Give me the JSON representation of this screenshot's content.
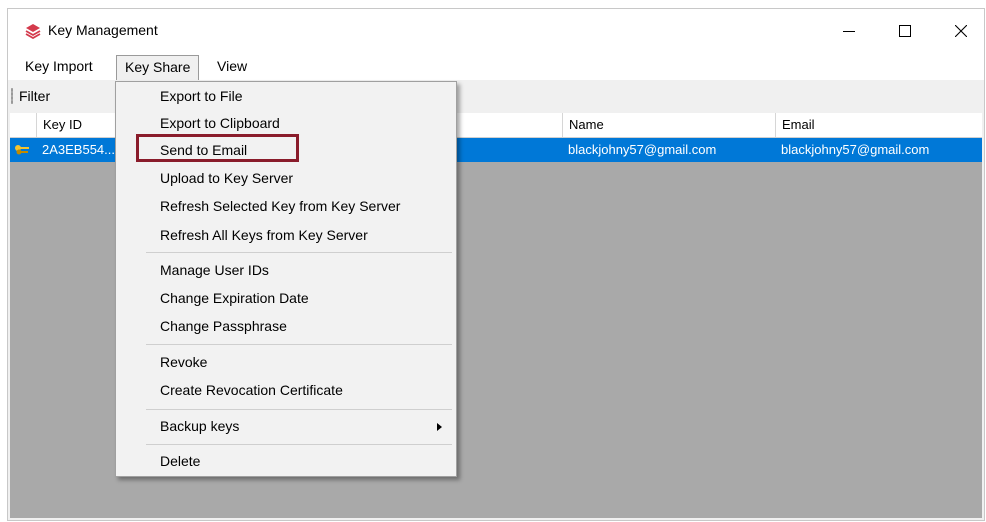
{
  "window": {
    "title": "Key Management"
  },
  "menubar": {
    "items": [
      "Key Import",
      "Key Share",
      "View"
    ]
  },
  "toolbar": {
    "filter_label": "Filter"
  },
  "table": {
    "columns": [
      "Key ID",
      "Name",
      "Email"
    ],
    "rows": [
      {
        "key_id": "2A3EB554...",
        "name": "blackjohny57@gmail.com",
        "email": "blackjohny57@gmail.com"
      }
    ]
  },
  "context_menu": {
    "items": [
      "Export to File",
      "Export to Clipboard",
      "Send to Email",
      "Upload to Key Server",
      "Refresh Selected Key from Key Server",
      "Refresh All Keys from Key Server",
      "Manage User IDs",
      "Change Expiration Date",
      "Change Passphrase",
      "Revoke",
      "Create Revocation Certificate",
      "Backup keys",
      "Delete"
    ],
    "highlighted": "Send to Email"
  },
  "colors": {
    "selection": "#0078d7",
    "highlight_box": "#8a1c2b",
    "grid_bg": "#a9a9a9"
  },
  "icons": {
    "app": "key-management-logo-icon",
    "row": "key-pair-icon"
  }
}
